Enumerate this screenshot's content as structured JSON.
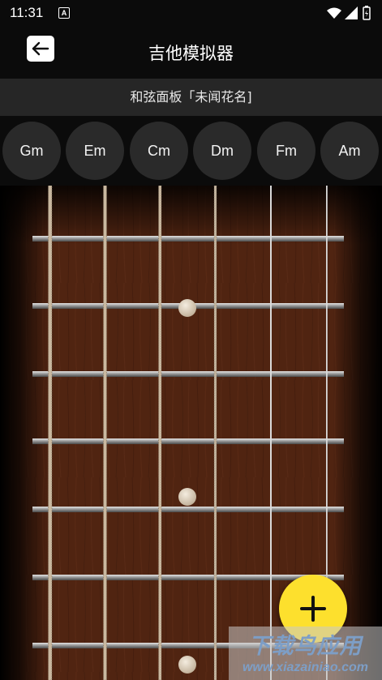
{
  "status_bar": {
    "time": "11:31",
    "notification_badge": "A"
  },
  "header": {
    "title": "吉他模拟器",
    "back_icon": "arrow-left-icon"
  },
  "chord_panel": {
    "label": "和弦面板「未闻花名]"
  },
  "chords": [
    {
      "label": "Gm"
    },
    {
      "label": "Em"
    },
    {
      "label": "Cm"
    },
    {
      "label": "Dm"
    },
    {
      "label": "Fm"
    },
    {
      "label": "Am"
    }
  ],
  "fab": {
    "icon": "plus-icon",
    "color": "#fde02d"
  },
  "watermark": {
    "text": "下载鸟应用",
    "url": "www.xiazainiao.com"
  },
  "colors": {
    "fretboard": "#5e2a14",
    "accent": "#fde02d",
    "chip": "#2a2a2a"
  }
}
